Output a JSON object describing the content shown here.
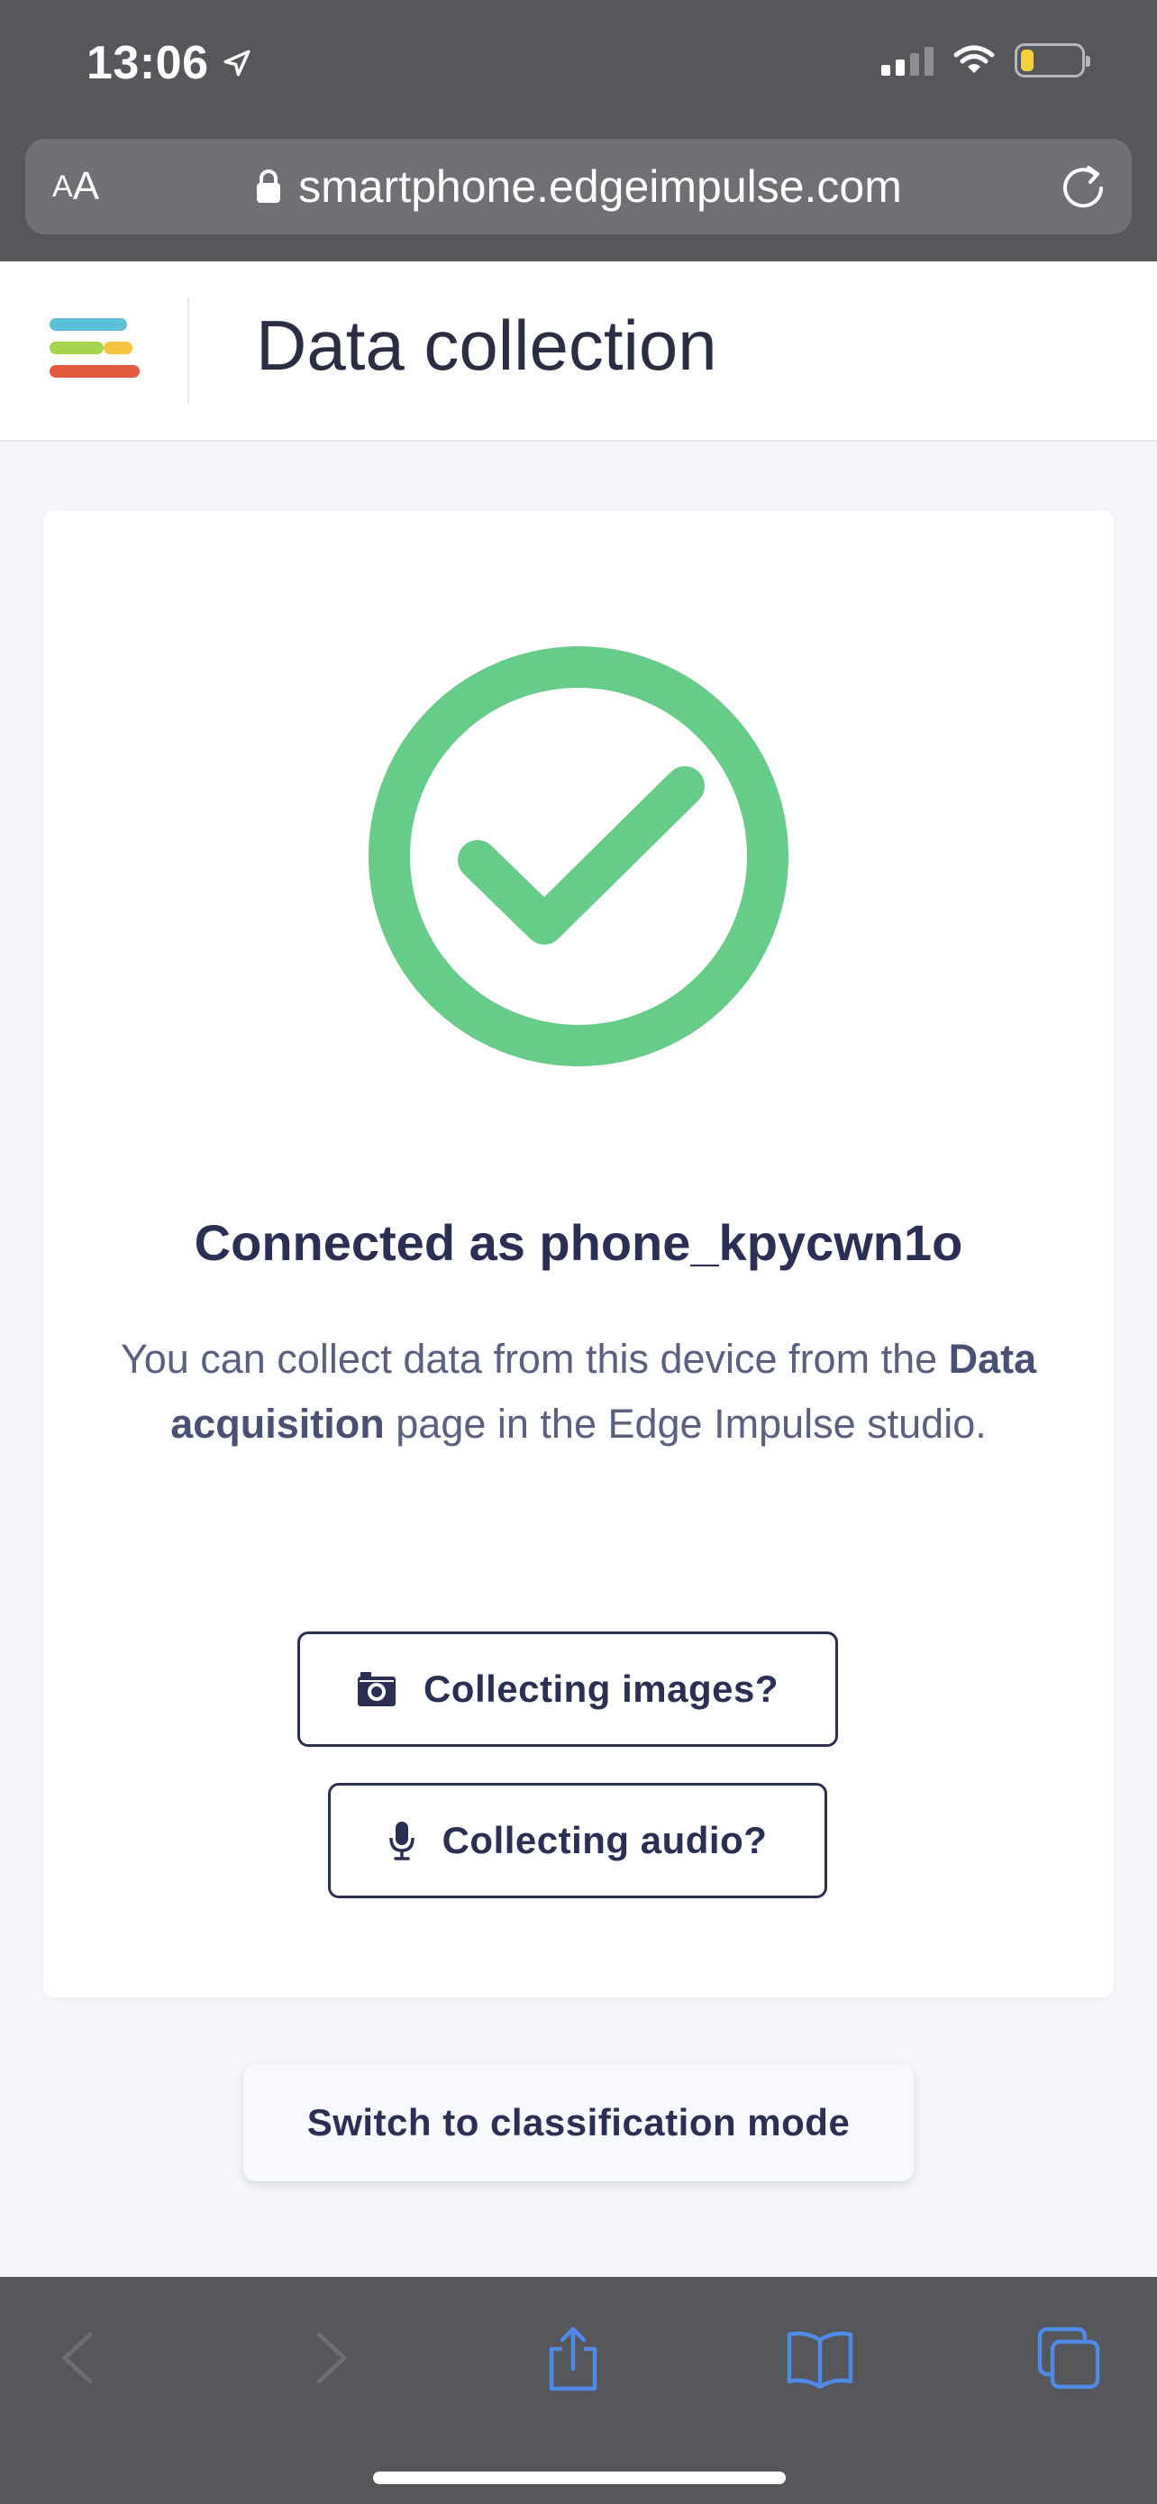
{
  "status_bar": {
    "time": "13:06",
    "location_icon": "location-arrow-icon",
    "signal_icon": "cellular-signal-icon",
    "wifi_icon": "wifi-icon",
    "battery_icon": "battery-icon",
    "battery_level": 0.2
  },
  "browser": {
    "aa_label_small": "A",
    "aa_label_large": "A",
    "lock_icon": "lock-icon",
    "url": "smartphone.edgeimpulse.com",
    "reload_icon": "reload-icon",
    "toolbar_icons": [
      "back-icon",
      "forward-icon",
      "share-icon",
      "bookmarks-icon",
      "tabs-icon"
    ]
  },
  "header": {
    "logo": "edge-impulse-logo",
    "title": "Data collection"
  },
  "card": {
    "status_icon": "check-circle-icon",
    "connected_title": "Connected as phone_kpycwn1o",
    "info_before": "You can collect data from this device from the ",
    "info_bold": "Data acquisition",
    "info_after": " page in the Edge Impulse studio.",
    "images_button": "Collecting images?",
    "images_icon": "camera-icon",
    "audio_button": "Collecting audio?",
    "audio_icon": "microphone-icon"
  },
  "switch_button": "Switch to classification mode",
  "colors": {
    "chrome": "#56575b",
    "success_green": "#66cc8a",
    "primary_text": "#2c2f54",
    "browser_blue": "#4e8ae6",
    "logo_blue": "#5bc0d8",
    "logo_green": "#a8d34f",
    "logo_yellow": "#f5c542",
    "logo_red": "#e5593d"
  }
}
